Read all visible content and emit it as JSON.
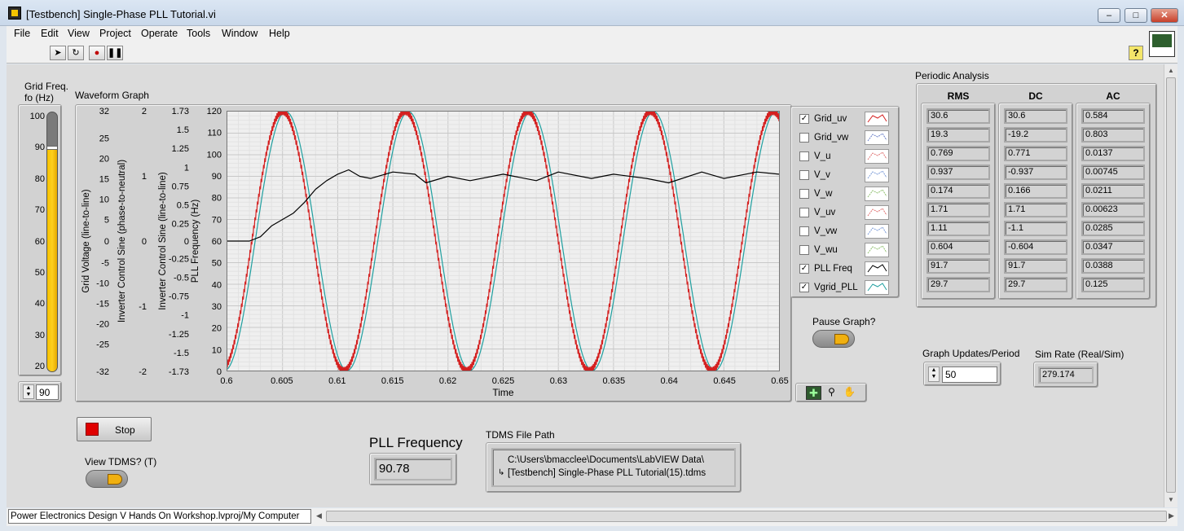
{
  "window": {
    "title": "[Testbench] Single-Phase PLL Tutorial.vi"
  },
  "menu": [
    "File",
    "Edit",
    "View",
    "Project",
    "Operate",
    "Tools",
    "Window",
    "Help"
  ],
  "grid_freq": {
    "label_line1": "Grid Freq.",
    "label_line2": "fo (Hz)",
    "value": "90",
    "ticks": [
      "100",
      "90",
      "80",
      "70",
      "60",
      "50",
      "40",
      "30",
      "20"
    ],
    "level_value": 90
  },
  "waveform": {
    "label": "Waveform Graph",
    "xlabel": "Time",
    "y_axis_labels": [
      "Grid Voltage (line-to-line)",
      "Inverter Control Sine (phase-to-neutral)",
      "Inverter Control Sine (line-to-line)",
      "PLL Frequency (Hz)"
    ]
  },
  "legend": [
    {
      "name": "Grid_uv",
      "checked": true,
      "color": "#d42020"
    },
    {
      "name": "Grid_vw",
      "checked": false,
      "color": "#6a7fc8"
    },
    {
      "name": "V_u",
      "checked": false,
      "color": "#e07070"
    },
    {
      "name": "V_v",
      "checked": false,
      "color": "#7a9ad8"
    },
    {
      "name": "V_w",
      "checked": false,
      "color": "#90c070"
    },
    {
      "name": "V_uv",
      "checked": false,
      "color": "#e07070"
    },
    {
      "name": "V_vw",
      "checked": false,
      "color": "#7a9ad8"
    },
    {
      "name": "V_wu",
      "checked": false,
      "color": "#90c070"
    },
    {
      "name": "PLL Freq",
      "checked": true,
      "color": "#000000"
    },
    {
      "name": "Vgrid_PLL",
      "checked": true,
      "color": "#20a0a0"
    }
  ],
  "periodic": {
    "title": "Periodic Analysis",
    "headers": [
      "RMS",
      "DC",
      "AC"
    ],
    "rms": [
      "30.6",
      "19.3",
      "0.769",
      "0.937",
      "0.174",
      "1.71",
      "1.11",
      "0.604",
      "91.7",
      "29.7"
    ],
    "dc": [
      "30.6",
      "-19.2",
      "0.771",
      "-0.937",
      "0.166",
      "1.71",
      "-1.1",
      "-0.604",
      "91.7",
      "29.7"
    ],
    "ac": [
      "0.584",
      "0.803",
      "0.0137",
      "0.00745",
      "0.0211",
      "0.00623",
      "0.0285",
      "0.0347",
      "0.0388",
      "0.125"
    ]
  },
  "controls": {
    "pause_label": "Pause Graph?",
    "updates_label": "Graph Updates/Period",
    "updates_value": "50",
    "simrate_label": "Sim Rate (Real/Sim)",
    "simrate_value": "279.174",
    "stop_label": "Stop",
    "view_tdms_label": "View TDMS? (T)",
    "pll_label": "PLL Frequency",
    "pll_value": "90.78",
    "tdms_label": "TDMS File Path",
    "tdms_line1": "C:\\Users\\bmacclee\\Documents\\LabVIEW Data\\",
    "tdms_line2": "[Testbench] Single-Phase PLL Tutorial(15).tdms"
  },
  "statusbar": {
    "context": "Power Electronics Design V Hands On Workshop.lvproj/My Computer"
  },
  "chart_data": {
    "type": "line",
    "xlabel": "Time",
    "ylabel": "PLL Frequency (Hz)",
    "xlim": [
      0.6,
      0.65
    ],
    "ylim": [
      0,
      120
    ],
    "x_ticks": [
      "0.6",
      "0.605",
      "0.61",
      "0.615",
      "0.62",
      "0.625",
      "0.63",
      "0.635",
      "0.64",
      "0.645",
      "0.65"
    ],
    "y_ticks": [
      "120",
      "110",
      "100",
      "90",
      "80",
      "70",
      "60",
      "50",
      "40",
      "30",
      "20",
      "10",
      "0"
    ],
    "axis1_ticks": [
      "32",
      "25",
      "20",
      "15",
      "10",
      "5",
      "0",
      "-5",
      "-10",
      "-15",
      "-20",
      "-25",
      "-32"
    ],
    "axis2_ticks": [
      "2",
      "1",
      "0",
      "-1",
      "-2"
    ],
    "axis3_ticks": [
      "1.73",
      "1.5",
      "1.25",
      "1",
      "0.75",
      "0.5",
      "0.25",
      "0",
      "-0.25",
      "-0.5",
      "-0.75",
      "-1",
      "-1.25",
      "-1.5",
      "-1.73"
    ],
    "series": [
      {
        "name": "Grid_uv",
        "frequency_hz": 90,
        "amplitude": 60,
        "offset": 60,
        "peaks_x": [
          0.605,
          0.6161,
          0.6272,
          0.6383,
          0.6494
        ]
      },
      {
        "name": "Vgrid_PLL",
        "frequency_hz": 90,
        "amplitude": 60,
        "offset": 60,
        "lag": 0.0003
      },
      {
        "name": "PLL Freq",
        "x": [
          0.6,
          0.602,
          0.603,
          0.604,
          0.605,
          0.606,
          0.607,
          0.608,
          0.609,
          0.61,
          0.611,
          0.612,
          0.613,
          0.615,
          0.617,
          0.618,
          0.62,
          0.622,
          0.625,
          0.628,
          0.63,
          0.633,
          0.635,
          0.638,
          0.64,
          0.643,
          0.645,
          0.648,
          0.65
        ],
        "y": [
          60,
          60,
          62,
          67,
          70,
          73,
          78,
          84,
          88,
          91,
          93,
          90,
          89,
          92,
          91,
          87,
          90,
          88,
          91,
          88,
          92,
          89,
          91,
          89,
          87,
          92,
          89,
          92,
          91
        ]
      }
    ]
  }
}
